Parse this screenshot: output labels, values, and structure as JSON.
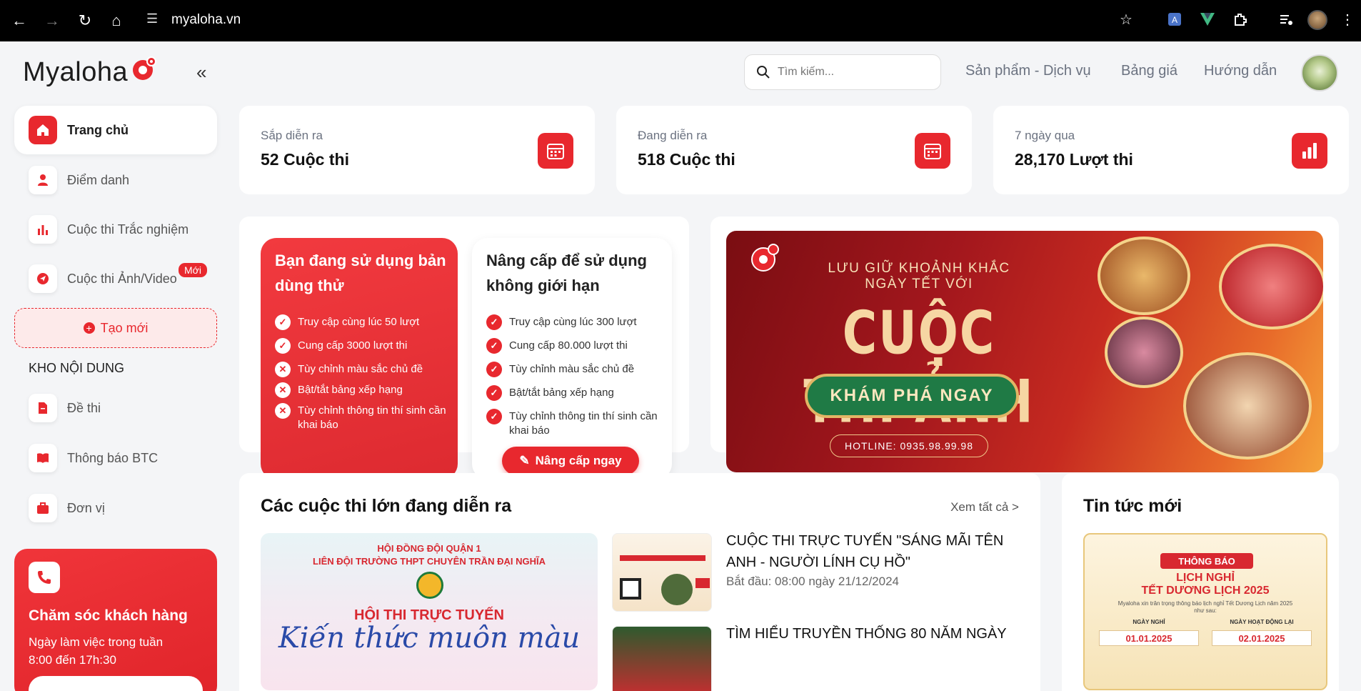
{
  "browser": {
    "url": "myaloha.vn"
  },
  "brand": {
    "logo_text": "Myaloha",
    "accent": "#e8282e"
  },
  "sidebar": {
    "items": [
      {
        "label": "Trang chủ",
        "icon": "home-icon"
      },
      {
        "label": "Điểm danh",
        "icon": "user-icon"
      },
      {
        "label": "Cuộc thi Trắc nghiệm",
        "icon": "bar-chart-icon"
      },
      {
        "label": "Cuộc thi Ảnh/Video",
        "icon": "send-icon",
        "badge": "Mới"
      }
    ],
    "create_label": "Tạo mới",
    "section_title": "KHO NỘI DUNG",
    "content_items": [
      {
        "label": "Đề thi",
        "icon": "document-icon"
      },
      {
        "label": "Thông báo BTC",
        "icon": "book-icon"
      },
      {
        "label": "Đơn vị",
        "icon": "briefcase-icon"
      }
    ],
    "care": {
      "title": "Chăm sóc khách hàng",
      "hours_line1": "Ngày làm việc trong tuần",
      "hours_line2": "8:00 đến 17h:30"
    }
  },
  "header": {
    "search_placeholder": "Tìm kiếm...",
    "nav": [
      "Sản phẩm - Dịch vụ",
      "Bảng giá",
      "Hướng dẫn"
    ]
  },
  "stats": [
    {
      "label": "Sắp diễn ra",
      "value": "52 Cuộc thi",
      "icon": "calendar-icon"
    },
    {
      "label": "Đang diễn ra",
      "value": "518 Cuộc thi",
      "icon": "calendar-icon"
    },
    {
      "label": "7 ngày qua",
      "value": "28,170 Lượt thi",
      "icon": "bar-chart-icon"
    }
  ],
  "plans": {
    "free": {
      "title": "Bạn đang sử dụng bản dùng thử",
      "features": [
        {
          "text": "Truy cập cùng lúc 50 lượt",
          "ok": true
        },
        {
          "text": "Cung cấp 3000 lượt thi",
          "ok": true
        },
        {
          "text": "Tùy chỉnh màu sắc chủ đề",
          "ok": false
        },
        {
          "text": "Bật/tắt bảng xếp hạng",
          "ok": false
        },
        {
          "text": "Tùy chỉnh thông tin thí sinh cần khai báo",
          "ok": false
        }
      ]
    },
    "pro": {
      "title": "Nâng cấp để sử dụng không giới hạn",
      "features": [
        {
          "text": "Truy cập cùng lúc 300 lượt",
          "ok": true
        },
        {
          "text": "Cung cấp 80.000 lượt thi",
          "ok": true
        },
        {
          "text": "Tùy chỉnh màu sắc chủ đề",
          "ok": true
        },
        {
          "text": "Bật/tắt bảng xếp hạng",
          "ok": true
        },
        {
          "text": "Tùy chỉnh thông tin thí sinh cần khai báo",
          "ok": true
        }
      ],
      "button": "Nâng cấp ngay"
    }
  },
  "banner": {
    "line1": "LƯU GIỮ KHOẢNH KHẮC",
    "line2": "NGÀY TẾT VỚI",
    "title": "CUỘC THI ẢNH",
    "cta": "KHÁM PHÁ NGAY",
    "hotline": "HOTLINE: 0935.98.99.98"
  },
  "contests": {
    "heading": "Các cuộc thi lớn đang diễn ra",
    "see_all": "Xem tất cả >",
    "feature": {
      "line1": "HỘI ĐỒNG ĐỘI QUẬN 1",
      "line2": "LIÊN ĐỘI TRƯỜNG THPT CHUYÊN TRẦN ĐẠI NGHĨA",
      "line3": "HỘI THI TRỰC TUYẾN",
      "line4": "Kiến thức muôn màu"
    },
    "items": [
      {
        "title": "CUỘC THI TRỰC TUYẾN \"SÁNG MÃI TÊN ANH - NGƯỜI LÍNH CỤ HỒ\"",
        "date": "Bắt đầu: 08:00 ngày 21/12/2024"
      },
      {
        "title": "TÌM HIỂU TRUYỀN THỐNG 80 NĂM NGÀY",
        "date": ""
      }
    ]
  },
  "news": {
    "heading": "Tin tức mới",
    "badge": "THÔNG BÁO",
    "title_line1": "LỊCH NGHỈ",
    "title_line2": "TẾT DƯƠNG LỊCH 2025",
    "subtitle": "Myaloha xin trân trọng thông báo lịch nghỉ Tết Dương Lịch năm 2025 như sau:",
    "col1_label": "NGÀY NGHỈ",
    "col1_value": "01.01.2025",
    "col2_label": "NGÀY HOẠT ĐỘNG LẠI",
    "col2_value": "02.01.2025"
  }
}
